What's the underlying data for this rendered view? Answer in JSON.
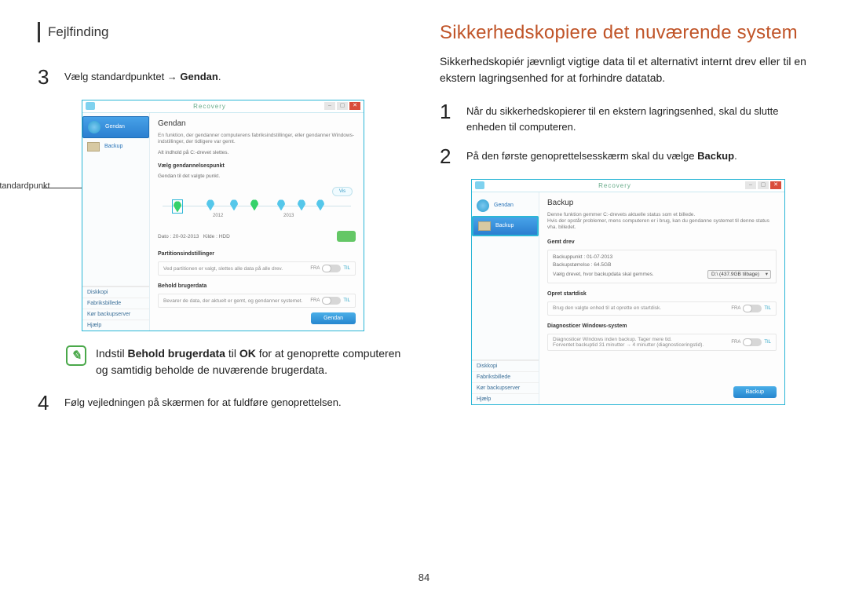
{
  "header": {
    "breadcrumb": "Fejlfinding"
  },
  "left": {
    "step3": {
      "num": "3",
      "prefix": "Vælg standardpunktet → ",
      "bold": "Gendan",
      "suffix": "."
    },
    "callout": "Standardpunkt",
    "screenshot": {
      "title": "Recovery",
      "sidebar": {
        "items": [
          "Gendan",
          "Backup"
        ],
        "bottom": [
          "Diskkopi",
          "Fabriksbillede",
          "Kør backupserver",
          "Hjælp"
        ]
      },
      "pane": {
        "title": "Gendan",
        "desc": "En funktion, der gendanner computerens fabriksindstillinger, eller gendanner Windows-indstillinger, der tidligere var gemt.",
        "alert": "Alt indhold på C:-drevet slettes.",
        "section_point": "Vælg gendannelsespunkt",
        "point_sub": "Gendan til det valgte punkt.",
        "timeline": {
          "button": "Vis",
          "years": [
            "2012",
            "2013"
          ]
        },
        "date_row": {
          "label": "Dato : 20-02-2013",
          "kilde": "Kilde :  HDD"
        },
        "section_part": "Partitionsindstillinger",
        "part_desc": "Ved partitionen er valgt, slettes alle data på alle drev.",
        "part_toggle": {
          "off": "FRA",
          "on": "TIL"
        },
        "section_keep": "Behold brugerdata",
        "keep_desc": "Bevarer de data, der aktuelt er gemt, og gendanner systemet.",
        "keep_toggle": {
          "off": "FRA",
          "on": "TIL"
        },
        "button": "Gendan"
      }
    },
    "note": {
      "prefix": "Indstil ",
      "b1": "Behold brugerdata",
      "mid1": " til ",
      "b2": "OK",
      "suffix": " for at genoprette computeren og samtidig beholde de nuværende brugerdata."
    },
    "step4": {
      "num": "4",
      "text": "Følg vejledningen på skærmen for at fuldføre genoprettelsen."
    }
  },
  "right": {
    "heading": "Sikkerhedskopiere det nuværende system",
    "intro": "Sikkerhedskopiér jævnligt vigtige data til et alternativt internt drev eller til en ekstern lagringsenhed for at forhindre datatab.",
    "step1": {
      "num": "1",
      "text": "Når du sikkerhedskopierer til en ekstern lagringsenhed, skal du slutte enheden til computeren."
    },
    "step2": {
      "num": "2",
      "prefix": "På den første genoprettelsesskærm skal du vælge ",
      "bold": "Backup",
      "suffix": "."
    },
    "screenshot": {
      "title": "Recovery",
      "sidebar": {
        "items": [
          "Gendan",
          "Backup"
        ],
        "bottom": [
          "Diskkopi",
          "Fabriksbillede",
          "Kør backupserver",
          "Hjælp"
        ]
      },
      "pane": {
        "title": "Backup",
        "desc": "Denne funktion gemmer C:-drevets aktuelle status som et billede.",
        "desc2": "Hvis der opstår problemer, mens computeren er i brug, kan du gendanne systemet til denne status vha. billedet.",
        "section_saved": "Gemt drev",
        "saved_line1": "Backuppunkt : 01-07-2013",
        "saved_line2": "Backupstørrelse : 64.5GB",
        "drive_label": "Vælg drevet, hvor backupdata skal gemmes.",
        "drive_value": "D:\\ (437.9GB tilbage)",
        "section_boot": "Opret startdisk",
        "boot_desc": "Brug den valgte enhed til at oprette en startdisk.",
        "boot_toggle": {
          "off": "FRA",
          "on": "TIL"
        },
        "section_diag": "Diagnosticer Windows-system",
        "diag_desc": "Diagnosticer Windows inden backup. Tager mere tid.",
        "diag_desc2": "Forventet backuptid 31 minutter → 4 minutter (diagnosticeringstid).",
        "diag_toggle": {
          "off": "FRA",
          "on": "TIL"
        },
        "button": "Backup"
      }
    }
  },
  "page_number": "84"
}
